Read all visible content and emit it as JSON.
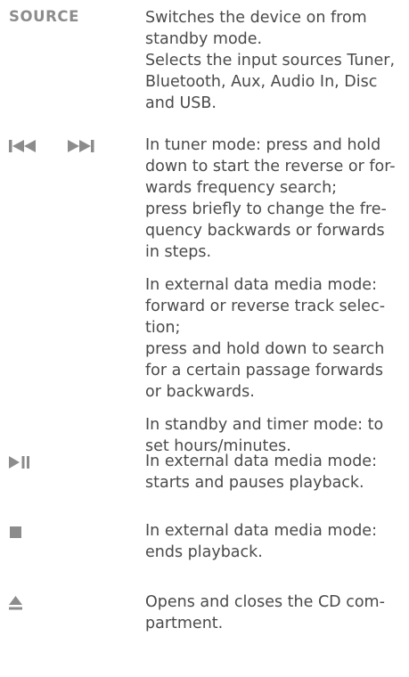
{
  "entries": [
    {
      "key_label": "SOURCE",
      "paragraphs": [
        [
          "Switches the device on from",
          "standby mode.",
          "Selects the input sources Tuner,",
          "Bluetooth, Aux, Audio In, Disc",
          "and USB."
        ]
      ]
    },
    {
      "key_icon": "skip-back-forward-icons",
      "paragraphs": [
        [
          "In tuner mode: press and hold",
          "down to start the reverse or for-",
          "wards frequency search;",
          "press briefly to change the fre-",
          "quency backwards or forwards",
          "in steps."
        ],
        [
          "In external data media mode:",
          "forward or reverse track selec-",
          "tion;",
          "press and hold down to search",
          "for a certain passage forwards",
          "or backwards."
        ],
        [
          "In standby and timer mode: to",
          "set hours/minutes."
        ]
      ]
    },
    {
      "key_icon": "play-pause-icon",
      "paragraphs": [
        [
          "In external data media mode:",
          "starts and pauses playback."
        ]
      ]
    },
    {
      "key_icon": "stop-icon",
      "paragraphs": [
        [
          "In external data media mode:",
          "ends playback."
        ]
      ]
    },
    {
      "key_icon": "eject-icon",
      "paragraphs": [
        [
          "Opens and closes the CD com-",
          "partment."
        ]
      ]
    }
  ],
  "colors": {
    "text": "#4a4a4a",
    "key": "#8c8c8c"
  }
}
